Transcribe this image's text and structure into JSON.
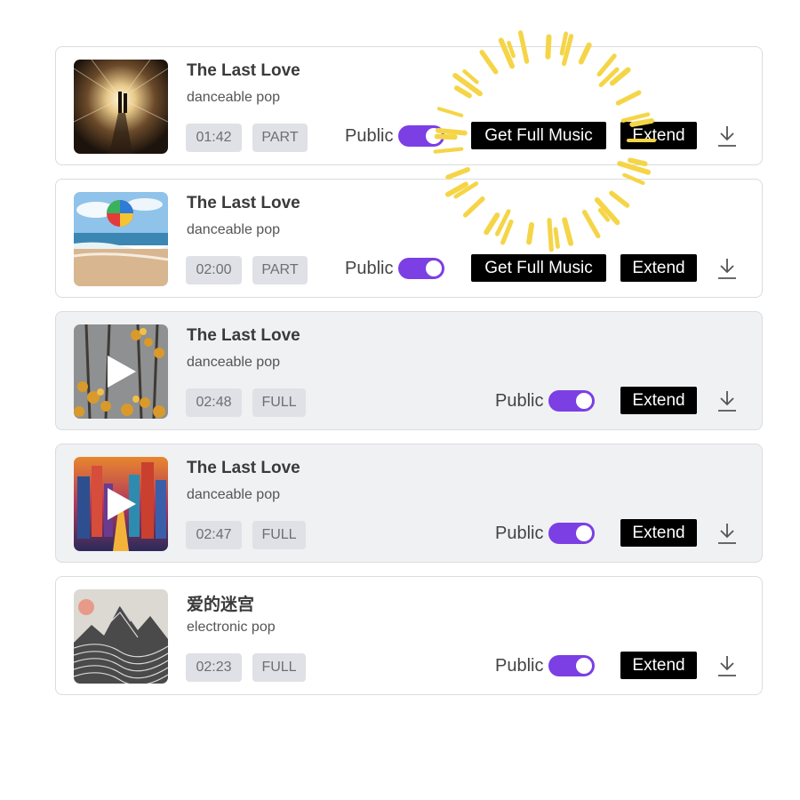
{
  "tracks": [
    {
      "title": "The Last Love",
      "genre": "danceable pop",
      "duration": "01:42",
      "kind": "PART",
      "public_label": "Public",
      "get_full_label": "Get Full Music",
      "extend_label": "Extend"
    },
    {
      "title": "The Last Love",
      "genre": "danceable pop",
      "duration": "02:00",
      "kind": "PART",
      "public_label": "Public",
      "get_full_label": "Get Full Music",
      "extend_label": "Extend"
    },
    {
      "title": "The Last Love",
      "genre": "danceable pop",
      "duration": "02:48",
      "kind": "FULL",
      "public_label": "Public",
      "extend_label": "Extend"
    },
    {
      "title": "The Last Love",
      "genre": "danceable pop",
      "duration": "02:47",
      "kind": "FULL",
      "public_label": "Public",
      "extend_label": "Extend"
    },
    {
      "title": "爱的迷宫",
      "genre": "electronic pop",
      "duration": "02:23",
      "kind": "FULL",
      "public_label": "Public",
      "extend_label": "Extend"
    }
  ],
  "colors": {
    "toggle_on": "#7b3fe4",
    "spinner": "#f5d547",
    "button_bg": "#000000"
  },
  "icons": {
    "download": "download-icon",
    "play": "play-icon"
  }
}
